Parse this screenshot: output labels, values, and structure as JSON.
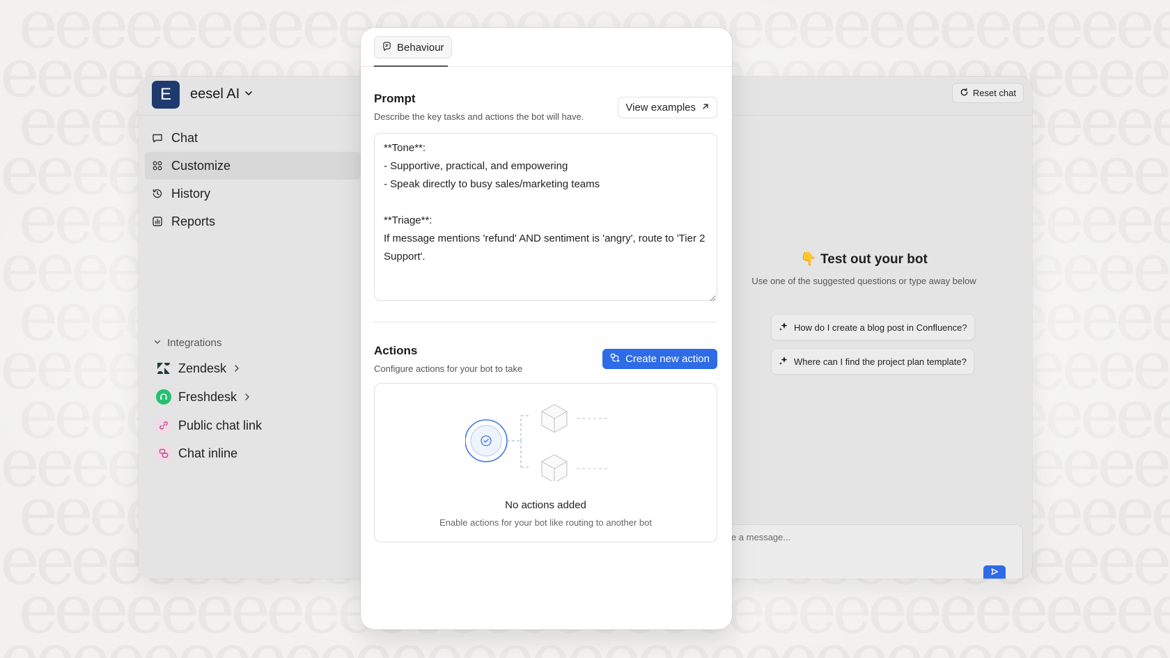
{
  "workspace": {
    "avatar_letter": "E",
    "name": "eesel AI"
  },
  "header": {
    "reset_chat_label": "Reset chat"
  },
  "sidebar": {
    "items": [
      {
        "label": "Chat",
        "icon": "chat-bubble-icon"
      },
      {
        "label": "Customize",
        "icon": "grid-icon",
        "active": true
      },
      {
        "label": "History",
        "icon": "history-icon"
      },
      {
        "label": "Reports",
        "icon": "bar-chart-icon"
      }
    ],
    "integrations_title": "Integrations",
    "integrations": [
      {
        "label": "Zendesk",
        "icon": "zendesk-icon"
      },
      {
        "label": "Freshdesk",
        "icon": "freshdesk-icon"
      },
      {
        "label": "Public chat link",
        "icon": "link-icon"
      },
      {
        "label": "Chat inline",
        "icon": "chat-inline-icon"
      }
    ]
  },
  "panel": {
    "tab_label": "Behaviour",
    "prompt": {
      "title": "Prompt",
      "subtitle": "Describe the key tasks and actions the bot will have.",
      "view_examples_label": "View examples",
      "value": "**Tone**:\n- Supportive, practical, and empowering\n- Speak directly to busy sales/marketing teams\n\n**Triage**:\nIf message mentions 'refund' AND sentiment is 'angry', route to 'Tier 2 Support'."
    },
    "actions": {
      "title": "Actions",
      "subtitle": "Configure actions for your bot to take",
      "create_label": "Create new action",
      "empty_title": "No actions added",
      "empty_subtitle": "Enable actions for your bot like routing to another bot"
    }
  },
  "test_bot": {
    "emoji": "👇",
    "title": "Test out your bot",
    "subtitle": "Use one of the suggested questions or type away below",
    "suggestions": [
      "How do I create a blog post in Confluence?",
      "Where can I find the project plan template?"
    ],
    "message_placeholder": "Type a message..."
  },
  "colors": {
    "accent": "#2e6be6",
    "workspace_avatar": "#1e3a6e",
    "freshdesk": "#25c16f",
    "link_icon": "#c0508a"
  }
}
